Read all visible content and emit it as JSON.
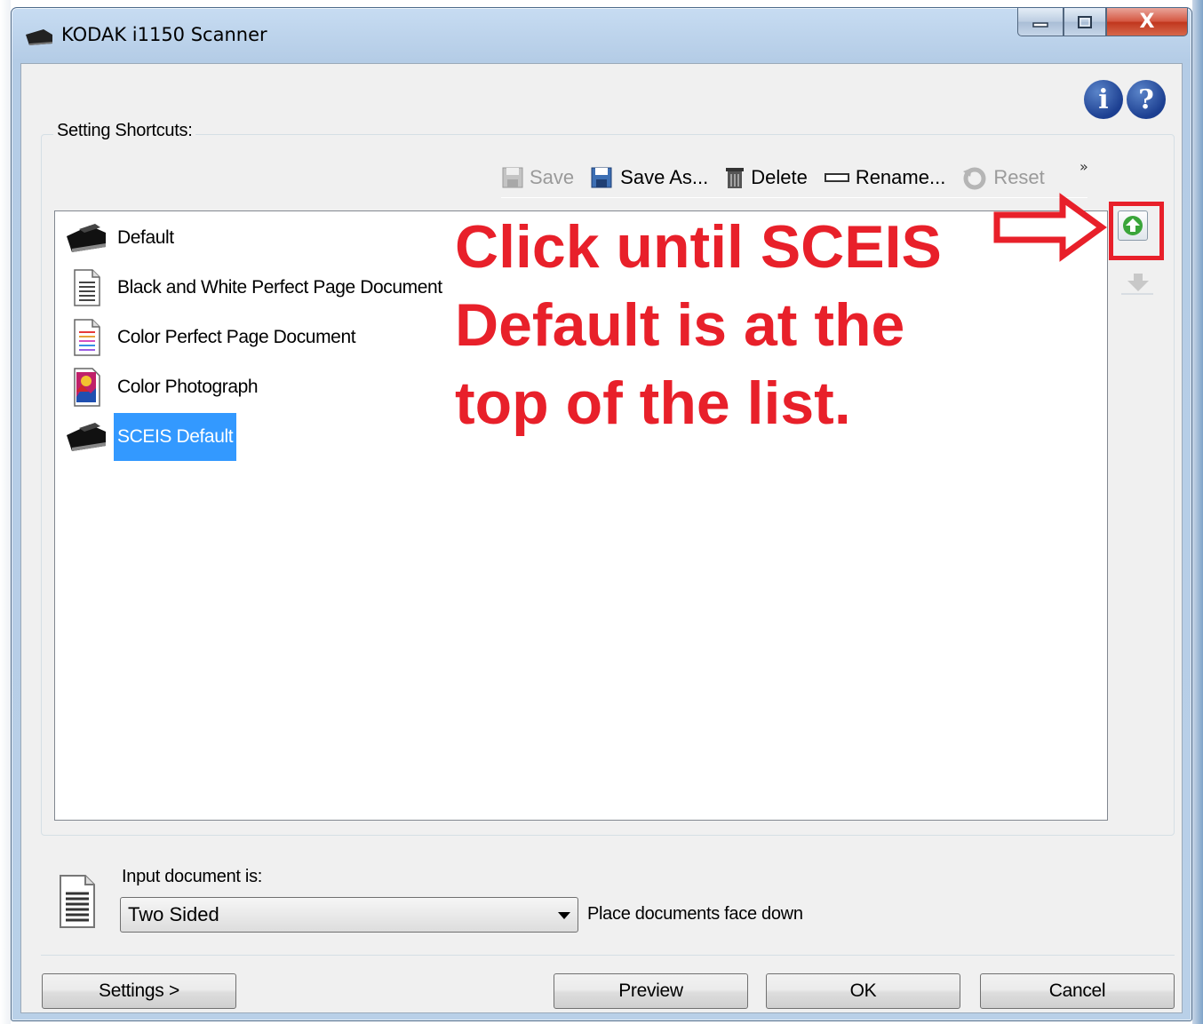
{
  "window": {
    "title": "KODAK i1150 Scanner",
    "minimize_icon": "minimize-icon",
    "maximize_icon": "maximize-icon",
    "close_label": "X"
  },
  "help_icons": [
    "info-icon",
    "help-icon"
  ],
  "shortcuts": {
    "group_label": "Setting Shortcuts:",
    "toolbar": {
      "save_label": "Save",
      "save_as_label": "Save As...",
      "delete_label": "Delete",
      "rename_label": "Rename...",
      "reset_label": "Reset",
      "more_label": "»"
    },
    "items": [
      {
        "label": "Default",
        "icon": "scanner-icon",
        "selected": false
      },
      {
        "label": "Black and White Perfect Page Document",
        "icon": "bw-document-icon",
        "selected": false
      },
      {
        "label": "Color Perfect Page Document",
        "icon": "color-document-icon",
        "selected": false
      },
      {
        "label": "Color Photograph",
        "icon": "color-photo-icon",
        "selected": false
      },
      {
        "label": "SCEIS Default",
        "icon": "scanner-icon",
        "selected": true
      }
    ]
  },
  "annotation": {
    "lines": [
      "Click until SCEIS",
      "Default is at the",
      "top of the list."
    ],
    "color": "#e8202a"
  },
  "input": {
    "label": "Input document is:",
    "value": "Two Sided",
    "note": "Place documents face down"
  },
  "buttons": {
    "settings": "Settings >",
    "preview": "Preview",
    "ok": "OK",
    "cancel": "Cancel"
  },
  "colors": {
    "selection": "#3399ff",
    "annotation_red": "#e8202a",
    "move_up_green": "#3aa53a"
  }
}
